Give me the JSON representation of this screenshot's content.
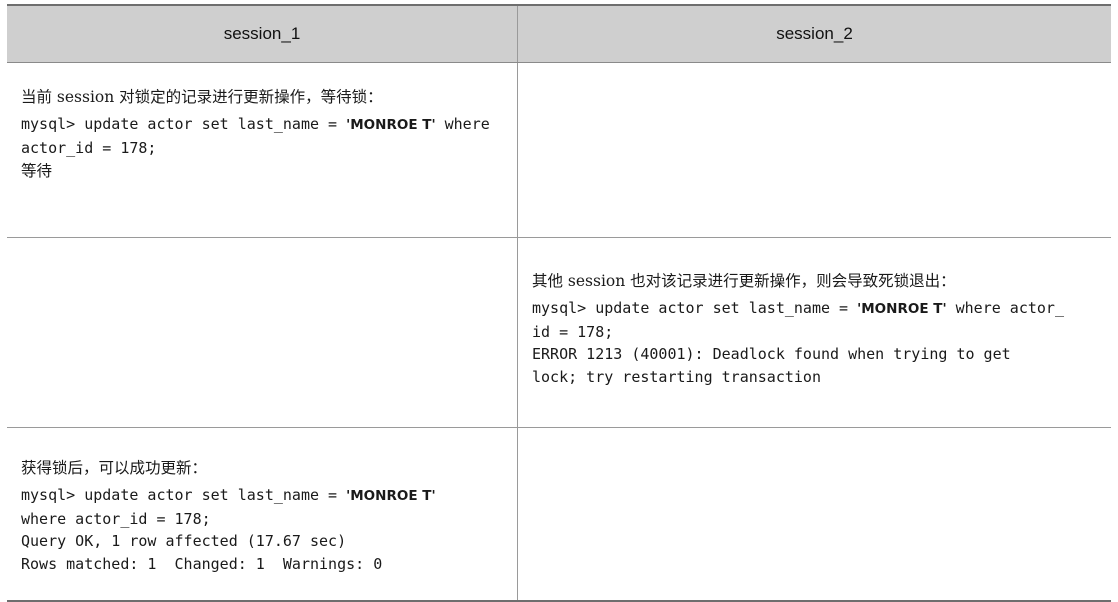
{
  "table": {
    "headers": [
      "session_1",
      "session_2"
    ],
    "row1": {
      "left": {
        "desc": "当前 session 对锁定的记录进行更新操作，等待锁：",
        "code_l1_pre": "mysql> update actor set last_name = ",
        "code_l1_quoted": "'MONROE T'",
        "code_l1_post": " where",
        "code_l2": "actor_id = 178;",
        "status": "等待"
      }
    },
    "row2": {
      "right": {
        "desc": "其他 session 也对该记录进行更新操作，则会导致死锁退出：",
        "code_l1_pre": "mysql> update actor set last_name = ",
        "code_l1_quoted": "'MONROE T'",
        "code_l1_post": " where actor_",
        "code_l2": "id = 178;",
        "code_l3": "ERROR 1213 (40001): Deadlock found when trying to get",
        "code_l4": "lock; try restarting transaction"
      }
    },
    "row3": {
      "left": {
        "desc": "获得锁后，可以成功更新：",
        "code_l1_pre": "mysql> update actor set last_name = ",
        "code_l1_quoted": "'MONROE T'",
        "code_l2": "where actor_id = 178;",
        "code_l3": "Query OK, 1 row affected (17.67 sec)",
        "code_l4": "Rows matched: 1  Changed: 1  Warnings: 0"
      }
    }
  }
}
